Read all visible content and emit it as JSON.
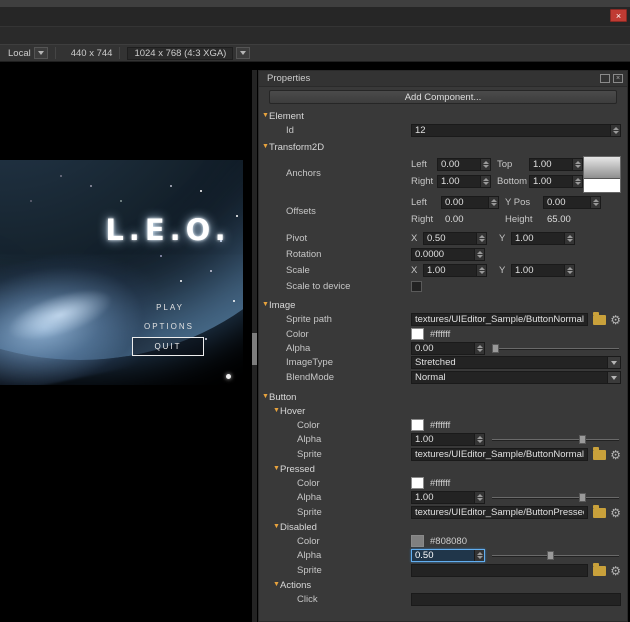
{
  "icons": {
    "close": "×",
    "panel_close": "×",
    "dropdown": "▼",
    "section_arrow": "▼",
    "gear": "⚙"
  },
  "colors": {
    "accent_arrow": "#e8a33d",
    "focus_border": "#62aef0",
    "close_button": "#c03b33",
    "image_swatch": "#ffffff",
    "disabled_swatch": "#808080"
  },
  "toolbar": {
    "coord_space": "Local",
    "canvas_size": "440 x 744",
    "resolution": "1024 x 768 (4:3 XGA)"
  },
  "preview": {
    "title": "L.E.O.",
    "play": "PLAY",
    "options": "OPTIONS",
    "quit": "QUIT"
  },
  "panel": {
    "title": "Properties",
    "add_component": "Add Component...",
    "element": {
      "header": "Element",
      "id_label": "Id",
      "id": "12"
    },
    "transform": {
      "header": "Transform2D",
      "anchors_label": "Anchors",
      "anchor_left_label": "Left",
      "anchor_left": "0.00",
      "anchor_top_label": "Top",
      "anchor_top": "1.00",
      "anchor_right_label": "Right",
      "anchor_right": "1.00",
      "anchor_bottom_label": "Bottom",
      "anchor_bottom": "1.00",
      "offsets_label": "Offsets",
      "offset_left_label": "Left",
      "offset_left": "0.00",
      "offset_ypos_label": "Y Pos",
      "offset_ypos": "0.00",
      "offset_right_label": "Right",
      "offset_right": "0.00",
      "offset_height_label": "Height",
      "offset_height": "65.00",
      "pivot_label": "Pivot",
      "x_label": "X",
      "y_label": "Y",
      "pivot_x": "0.50",
      "pivot_y": "1.00",
      "rotation_label": "Rotation",
      "rotation": "0.0000",
      "scale_label": "Scale",
      "scale_x": "1.00",
      "scale_y": "1.00",
      "scale_to_device_label": "Scale to device"
    },
    "image": {
      "header": "Image",
      "sprite_path_label": "Sprite path",
      "sprite_path": "textures/UIEditor_Sample/ButtonNormal.tif",
      "color_label": "Color",
      "color_hex": "#ffffff",
      "alpha_label": "Alpha",
      "alpha": "0.00",
      "image_type_label": "ImageType",
      "image_type": "Stretched",
      "blend_mode_label": "BlendMode",
      "blend_mode": "Normal"
    },
    "button": {
      "header": "Button",
      "hover": {
        "header": "Hover",
        "color_label": "Color",
        "color_hex": "#ffffff",
        "alpha_label": "Alpha",
        "alpha": "1.00",
        "sprite_label": "Sprite",
        "sprite": "textures/UIEditor_Sample/ButtonNormal.tif"
      },
      "pressed": {
        "header": "Pressed",
        "color_label": "Color",
        "color_hex": "#ffffff",
        "alpha_label": "Alpha",
        "alpha": "1.00",
        "sprite_label": "Sprite",
        "sprite": "textures/UIEditor_Sample/ButtonPressed.tif"
      },
      "disabled": {
        "header": "Disabled",
        "color_label": "Color",
        "color_hex": "#808080",
        "alpha_label": "Alpha",
        "alpha": "0.50",
        "sprite_label": "Sprite",
        "sprite": ""
      },
      "actions": {
        "header": "Actions",
        "click_label": "Click",
        "click": ""
      }
    }
  }
}
